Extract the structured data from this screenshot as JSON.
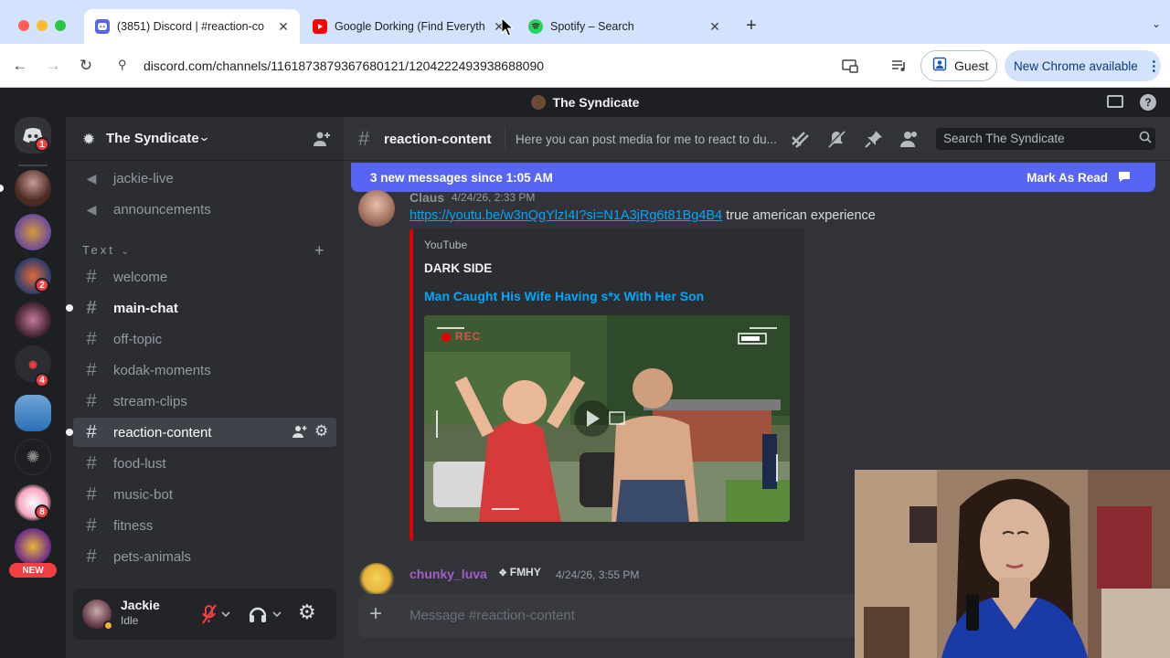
{
  "browser": {
    "tabs": [
      {
        "title": "(3851) Discord | #reaction-co",
        "favicon": "discord-icon",
        "active": true
      },
      {
        "title": "Google Dorking (Find Everyth",
        "favicon": "youtube-icon",
        "active": false
      },
      {
        "title": "Spotify – Search",
        "favicon": "spotify-icon",
        "active": false
      }
    ],
    "new_tab_glyph": "+",
    "url": "discord.com/channels/1161873879367680121/1204222493938688090",
    "profile_label": "Guest",
    "update_label": "New Chrome available"
  },
  "discord": {
    "window_title": "The Syndicate",
    "server": {
      "name": "The Syndicate"
    },
    "servers": [
      {
        "name": "server-home",
        "badge": "1"
      },
      {
        "name": "server-2",
        "badge": ""
      },
      {
        "name": "server-3",
        "badge": ""
      },
      {
        "name": "server-4",
        "badge": "2"
      },
      {
        "name": "server-5",
        "badge": ""
      },
      {
        "name": "server-6",
        "badge": "4"
      },
      {
        "name": "server-7",
        "badge": ""
      },
      {
        "name": "server-8",
        "badge": ""
      },
      {
        "name": "server-9",
        "badge": "8"
      },
      {
        "name": "server-10",
        "badge": ""
      }
    ],
    "new_label": "NEW",
    "top_channels": [
      {
        "name": "jackie-live"
      },
      {
        "name": "announcements"
      }
    ],
    "category": "Text",
    "channels": [
      {
        "name": "welcome",
        "state": "read"
      },
      {
        "name": "main-chat",
        "state": "unread"
      },
      {
        "name": "off-topic",
        "state": "read"
      },
      {
        "name": "kodak-moments",
        "state": "read"
      },
      {
        "name": "stream-clips",
        "state": "read"
      },
      {
        "name": "reaction-content",
        "state": "selected"
      },
      {
        "name": "food-lust",
        "state": "read"
      },
      {
        "name": "music-bot",
        "state": "read"
      },
      {
        "name": "fitness",
        "state": "read"
      },
      {
        "name": "pets-animals",
        "state": "read"
      }
    ],
    "user": {
      "name": "Jackie",
      "status": "Idle"
    },
    "channel_header": {
      "name": "reaction-content",
      "topic": "Here you can post media for me to react to du...",
      "search_placeholder": "Search The Syndicate"
    },
    "new_messages_bar": {
      "text": "3 new messages since 1:05 AM",
      "action": "Mark As Read"
    },
    "messages": [
      {
        "author": "Claus",
        "timestamp": "4/24/26, 2:33 PM",
        "link": "https://youtu.be/w3nQgYlzI4I?si=N1A3jRg6t81Bg4B4",
        "text": " true american experience",
        "embed": {
          "provider": "YouTube",
          "author": "DARK SIDE",
          "title": "Man Caught His Wife Having s*x With Her Son",
          "rec_label": "REC"
        }
      },
      {
        "author": "chunky_luva",
        "tag": "FMHY",
        "timestamp": "4/24/26, 3:55 PM"
      }
    ],
    "composer_placeholder": "Message #reaction-content"
  },
  "colors": {
    "blurple": "#5865f2",
    "link": "#00a8fc",
    "unread_red": "#f23f43",
    "youtube_red": "#e00000"
  }
}
